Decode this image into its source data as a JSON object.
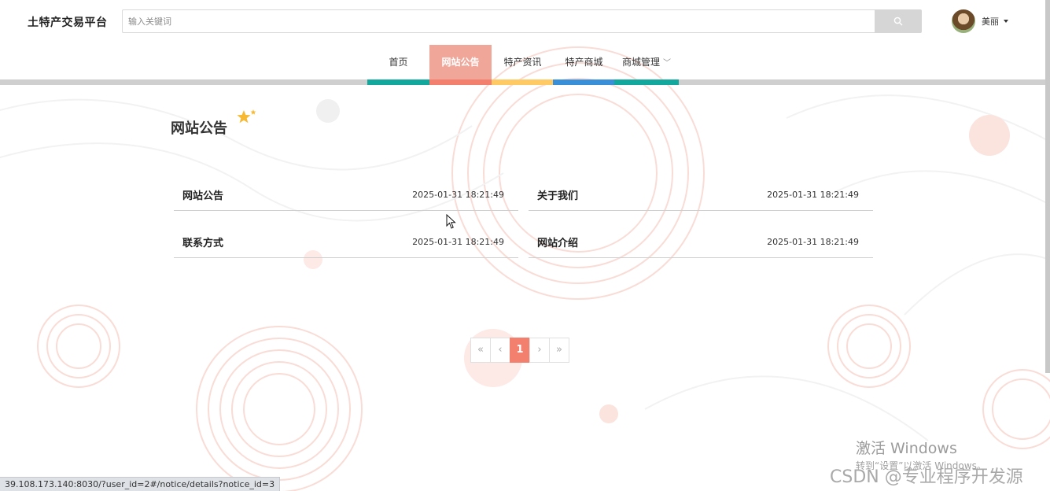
{
  "header": {
    "brand": "土特产交易平台",
    "search_placeholder": "输入关键词",
    "user_name": "美丽"
  },
  "nav": {
    "items": [
      {
        "label": "首页",
        "bar_color": "#13a89e"
      },
      {
        "label": "网站公告",
        "bar_color": "#f3806e"
      },
      {
        "label": "特产资讯",
        "bar_color": "#ffca64"
      },
      {
        "label": "特产商城",
        "bar_color": "#3a8fd9"
      },
      {
        "label": "商城管理",
        "bar_color": "#13a89e"
      }
    ],
    "active_index": 1
  },
  "main": {
    "page_title": "网站公告",
    "notices": [
      {
        "title": "网站公告",
        "time": "2025-01-31 18:21:49"
      },
      {
        "title": "关于我们",
        "time": "2025-01-31 18:21:49"
      },
      {
        "title": "联系方式",
        "time": "2025-01-31 18:21:49"
      },
      {
        "title": "网站介绍",
        "time": "2025-01-31 18:21:49"
      }
    ]
  },
  "pagination": {
    "first": "«",
    "prev": "‹",
    "current": "1",
    "next": "›",
    "last": "»"
  },
  "status_bar": {
    "url": "39.108.173.140:8030/?user_id=2#/notice/details?notice_id=3"
  },
  "watermarks": {
    "activate_title": "激活 Windows",
    "activate_sub": "转到“设置”以激活 Windows。",
    "csdn": "CSDN @专业程序开发源"
  },
  "colors": {
    "accent": "#f3806e",
    "active_nav_bg": "#f0a698"
  }
}
